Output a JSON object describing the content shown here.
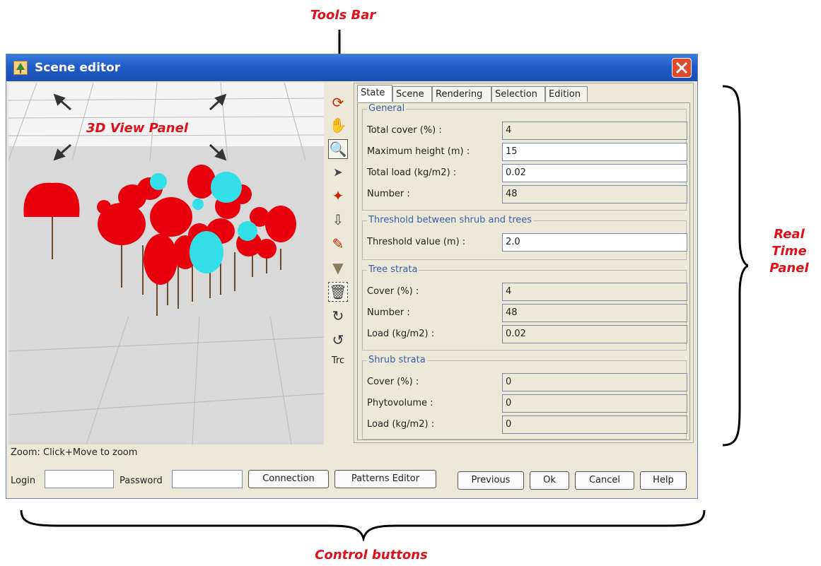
{
  "annotations": {
    "tools_bar": "Tools Bar",
    "view_panel": "3D View Panel",
    "real_time_panel": [
      "Real",
      "Time",
      "Panel"
    ],
    "control_buttons": "Control buttons"
  },
  "window": {
    "title": "Scene editor",
    "app_icon": "tree-icon",
    "close_icon": "close-icon"
  },
  "toolbar": {
    "tools": [
      "rotate-icon",
      "hand-icon",
      "zoom-icon",
      "pointer-icon",
      "pan-icon",
      "import-icon",
      "pencil-icon",
      "triangle-icon",
      "delete-icon",
      "undo-icon",
      "redo-icon"
    ],
    "text_tool": "Trc"
  },
  "tabs": [
    "State",
    "Scene",
    "Rendering",
    "Selection",
    "Edition"
  ],
  "active_tab": "State",
  "groups": {
    "general": {
      "title": "General",
      "rows": [
        {
          "label": "Total cover (%) :",
          "value": "4"
        },
        {
          "label": "Maximum height (m) :",
          "value": "15"
        },
        {
          "label": "Total load (kg/m2) :",
          "value": "0.02"
        },
        {
          "label": "Number :",
          "value": "48"
        }
      ]
    },
    "threshold": {
      "title": "Threshold between shrub and trees",
      "rows": [
        {
          "label": "Threshold value (m) :",
          "value": "2.0"
        }
      ]
    },
    "tree": {
      "title": "Tree strata",
      "rows": [
        {
          "label": "Cover (%) :",
          "value": "4"
        },
        {
          "label": "Number :",
          "value": "48"
        },
        {
          "label": "Load (kg/m2) :",
          "value": "0.02"
        }
      ]
    },
    "shrub": {
      "title": "Shrub strata",
      "rows": [
        {
          "label": "Cover (%) :",
          "value": "0"
        },
        {
          "label": "Phytovolume :",
          "value": "0"
        },
        {
          "label": "Load (kg/m2) :",
          "value": "0"
        }
      ]
    }
  },
  "status": "Zoom: Click+Move to zoom",
  "bottom": {
    "login_label": "Login",
    "login_value": "",
    "password_label": "Password",
    "password_value": "",
    "connection": "Connection",
    "patterns_editor": "Patterns Editor",
    "previous": "Previous",
    "ok": "Ok",
    "cancel": "Cancel",
    "help": "Help"
  },
  "colors": {
    "annotation": "#e0101a",
    "tree_red": "#e8000c",
    "tree_cyan": "#33dfe6"
  }
}
